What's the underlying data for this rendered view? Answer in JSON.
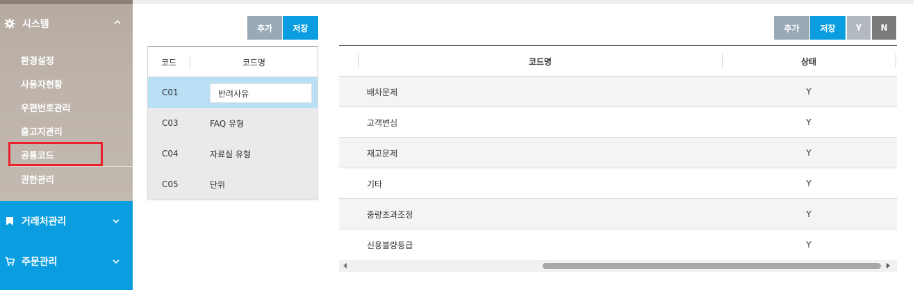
{
  "sidebar": {
    "system_menu": {
      "label": "시스템",
      "icon": "gear-icon",
      "expanded": true
    },
    "sub_items": [
      {
        "label": "환경설정"
      },
      {
        "label": "사용자현황"
      },
      {
        "label": "우편번호관리"
      },
      {
        "label": "출고지관리"
      },
      {
        "label": "공통코드",
        "highlighted": true
      },
      {
        "label": "권한관리"
      }
    ],
    "menus": [
      {
        "label": "거래처관리",
        "icon": "bookmark-icon"
      },
      {
        "label": "주문관리",
        "icon": "cart-icon"
      }
    ]
  },
  "left_panel": {
    "add_label": "추가",
    "save_label": "저장",
    "columns": [
      "코드",
      "코드명"
    ],
    "rows": [
      {
        "code": "C01",
        "name": "반려사유",
        "selected": true,
        "editing": true
      },
      {
        "code": "C03",
        "name": "FAQ 유형"
      },
      {
        "code": "C04",
        "name": "자료실 유형"
      },
      {
        "code": "C05",
        "name": "단위"
      }
    ]
  },
  "right_panel": {
    "add_label": "추가",
    "save_label": "저장",
    "y_label": "Y",
    "n_label": "N",
    "columns": [
      "코드명",
      "상태"
    ],
    "rows": [
      {
        "name": "배차문제",
        "status": "Y"
      },
      {
        "name": "고객변심",
        "status": "Y"
      },
      {
        "name": "재고문제",
        "status": "Y"
      },
      {
        "name": "기타",
        "status": "Y"
      },
      {
        "name": "중량초과조정",
        "status": "Y"
      },
      {
        "name": "신용불량등급",
        "status": "Y"
      }
    ]
  },
  "colors": {
    "accent_blue": "#0a9de0",
    "highlight_red": "#e8212a",
    "selected_row": "#b9e0f5"
  }
}
